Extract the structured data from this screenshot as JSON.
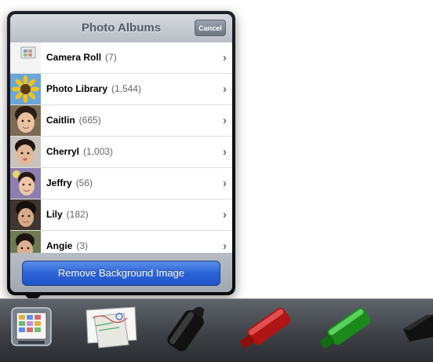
{
  "popover": {
    "title": "Photo Albums",
    "cancel_label": "Cancel",
    "remove_label": "Remove Background Image"
  },
  "albums": [
    {
      "name": "Camera Roll",
      "count": "(7)",
      "thumb": "camera-roll-thumbnail"
    },
    {
      "name": "Photo Library",
      "count": "(1,544)",
      "thumb": "sunflower-thumbnail"
    },
    {
      "name": "Caitlin",
      "count": "(665)",
      "thumb": "portrait-thumbnail"
    },
    {
      "name": "Cherryl",
      "count": "(1,003)",
      "thumb": "portrait-thumbnail"
    },
    {
      "name": "Jeffry",
      "count": "(56)",
      "thumb": "portrait-thumbnail"
    },
    {
      "name": "Lily",
      "count": "(182)",
      "thumb": "portrait-thumbnail"
    },
    {
      "name": "Angie",
      "count": "(3)",
      "thumb": "portrait-thumbnail"
    }
  ],
  "toolbar": {
    "tools": [
      {
        "name": "background-image-tool",
        "icon": "photo-grid-icon",
        "selected": true
      },
      {
        "name": "whiteboard-tool",
        "icon": "paper-sheet-icon",
        "selected": false
      },
      {
        "name": "black-marker-tool",
        "icon": "black-marker-icon",
        "selected": false
      },
      {
        "name": "red-marker-tool",
        "icon": "red-marker-icon",
        "selected": false
      },
      {
        "name": "green-marker-tool",
        "icon": "green-marker-icon",
        "selected": false
      },
      {
        "name": "eraser-tool",
        "icon": "eraser-icon",
        "selected": false
      }
    ]
  },
  "colors": {
    "accent_blue": "#2c63d6",
    "marker_black": "#111111",
    "marker_red": "#c41a1a",
    "marker_green": "#1f9a1f"
  }
}
